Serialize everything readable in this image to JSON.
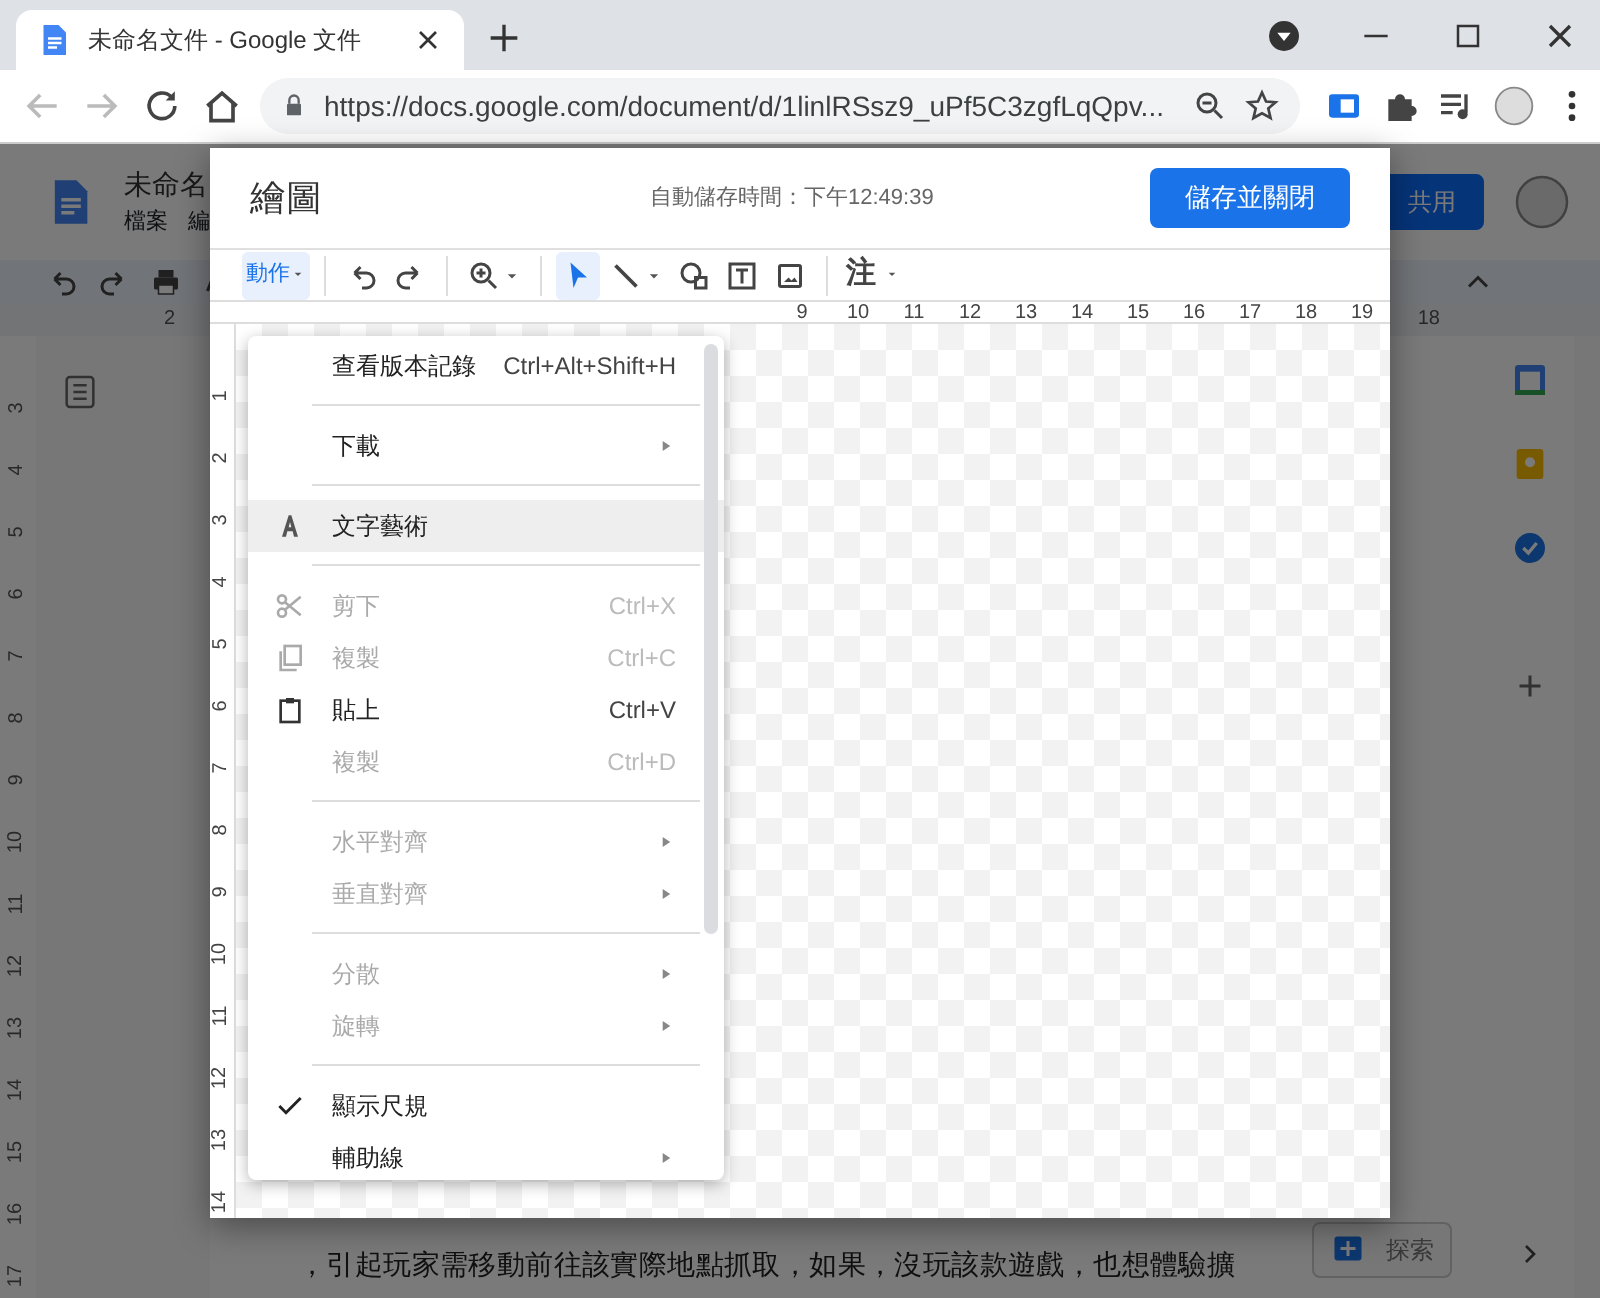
{
  "browser": {
    "tab_title": "未命名文件 - Google 文件",
    "url": "https://docs.google.com/document/d/1linlRSsz9_uPf5C3zgfLqQpv..."
  },
  "document": {
    "title": "未命名",
    "menus": [
      "檔案",
      "編"
    ],
    "share_button": "共用",
    "top_ruler": [
      "2",
      "18"
    ],
    "side_ruler": [
      "3",
      "4",
      "5",
      "6",
      "7",
      "8",
      "9",
      "10",
      "11",
      "12",
      "13",
      "14",
      "15",
      "16",
      "17"
    ],
    "body_text": "，引起玩家需移動前往該實際地點抓取，如果，沒玩該款遊戲，也想體驗擴",
    "explore_button": "探索"
  },
  "dialog": {
    "title": "繪圖",
    "autosave": "自動儲存時間：下午12:49:39",
    "save_button": "儲存並關閉",
    "actions_menu": {
      "label": "動作",
      "expanded": true
    },
    "note_menu": "注",
    "tools": [
      {
        "selected": false
      },
      {
        "selected": false
      },
      {
        "selected": false
      },
      {
        "selected": true
      },
      {
        "selected": false
      },
      {
        "selected": false
      },
      {
        "selected": false
      },
      {
        "selected": false
      }
    ],
    "top_ruler": [
      "9",
      "10",
      "11",
      "12",
      "13",
      "14",
      "15",
      "16",
      "17",
      "18",
      "19"
    ],
    "side_ruler": [
      "1",
      "2",
      "3",
      "4",
      "5",
      "6",
      "7",
      "8",
      "9",
      "10",
      "11",
      "12",
      "13",
      "14"
    ],
    "menu": [
      {
        "kind": "item",
        "label": "查看版本記錄",
        "shortcut": "Ctrl+Alt+Shift+H",
        "disabled": false,
        "submenu": false,
        "checked": false,
        "selected": false
      },
      {
        "kind": "separator"
      },
      {
        "kind": "item",
        "label": "下載",
        "disabled": false,
        "submenu": true,
        "checked": false,
        "selected": false
      },
      {
        "kind": "separator"
      },
      {
        "kind": "wordart",
        "label": "文字藝術",
        "disabled": false,
        "submenu": false,
        "checked": false,
        "selected": true
      },
      {
        "kind": "separator"
      },
      {
        "kind": "cut",
        "label": "剪下",
        "shortcut": "Ctrl+X",
        "disabled": true,
        "submenu": false,
        "checked": false,
        "selected": false
      },
      {
        "kind": "copy",
        "label": "複製",
        "shortcut": "Ctrl+C",
        "disabled": true,
        "submenu": false,
        "checked": false,
        "selected": false
      },
      {
        "kind": "paste",
        "label": "貼上",
        "shortcut": "Ctrl+V",
        "disabled": false,
        "submenu": false,
        "checked": false,
        "selected": false
      },
      {
        "kind": "item",
        "label": "複製",
        "shortcut": "Ctrl+D",
        "disabled": true,
        "submenu": false,
        "checked": false,
        "selected": false
      },
      {
        "kind": "separator"
      },
      {
        "kind": "item",
        "label": "水平對齊",
        "disabled": true,
        "submenu": true,
        "checked": false,
        "selected": false
      },
      {
        "kind": "item",
        "label": "垂直對齊",
        "disabled": true,
        "submenu": true,
        "checked": false,
        "selected": false
      },
      {
        "kind": "separator"
      },
      {
        "kind": "item",
        "label": "分散",
        "disabled": true,
        "submenu": true,
        "checked": false,
        "selected": false
      },
      {
        "kind": "item",
        "label": "旋轉",
        "disabled": true,
        "submenu": true,
        "checked": false,
        "selected": false
      },
      {
        "kind": "separator"
      },
      {
        "kind": "item",
        "label": "顯示尺規",
        "disabled": false,
        "submenu": false,
        "checked": true,
        "selected": false
      },
      {
        "kind": "item",
        "label": "輔助線",
        "disabled": false,
        "submenu": true,
        "checked": false,
        "selected": false
      }
    ]
  }
}
